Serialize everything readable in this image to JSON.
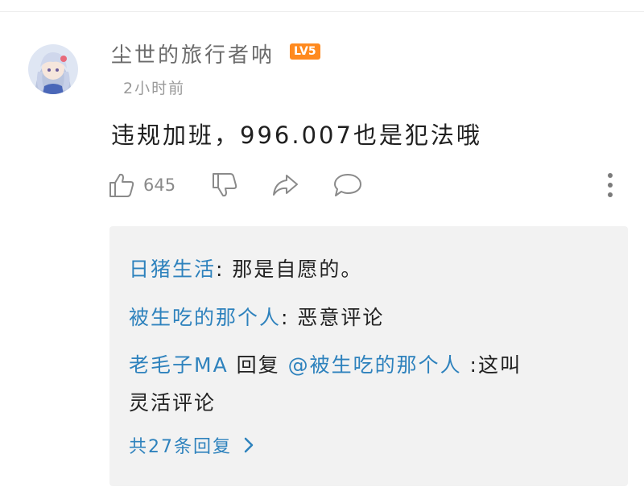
{
  "comment": {
    "username": "尘世的旅行者呐",
    "level": "LV5",
    "timestamp": "2小时前",
    "text": "违规加班，996.007也是犯法哦",
    "like_count": "645"
  },
  "icons": {
    "like": "thumbs-up-icon",
    "dislike": "thumbs-down-icon",
    "share": "share-icon",
    "reply": "comment-bubble-icon",
    "more": "more-vertical-icon",
    "view_more": "chevron-right-icon"
  },
  "colors": {
    "link": "#2e82bd",
    "level_badge": "#ff8a1f",
    "reply_box": "#f2f2f2"
  },
  "replies": [
    {
      "author": "日猪生活",
      "separator": ":",
      "text": " 那是自愿的。"
    },
    {
      "author": "被生吃的那个人",
      "separator": ":",
      "text": " 恶意评论"
    },
    {
      "author": "老毛子MA",
      "middle": " 回复 ",
      "mention": "@被生吃的那个人",
      "separator": " :",
      "text": "这叫",
      "text_cont": "灵活评论"
    }
  ],
  "view_more_label": "共27条回复"
}
